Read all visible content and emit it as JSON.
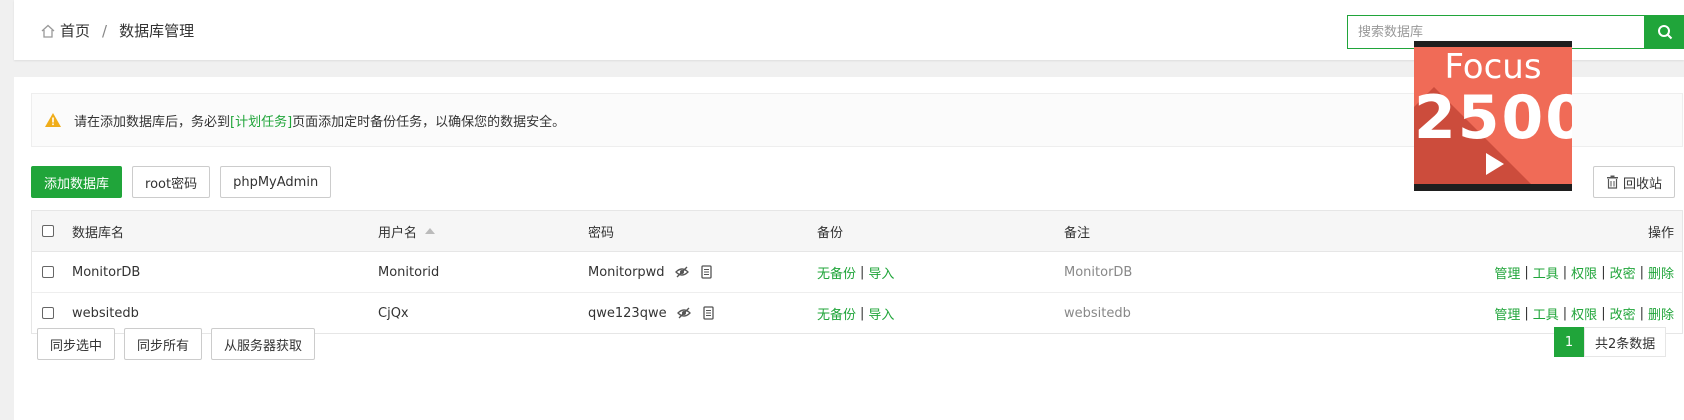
{
  "breadcrumb": {
    "home": "首页",
    "separator": "/",
    "current": "数据库管理"
  },
  "search": {
    "placeholder": "搜索数据库"
  },
  "notice": {
    "before": "请在添加数据库后，务必到",
    "link": "[计划任务]",
    "after": "页面添加定时备份任务，以确保您的数据安全。"
  },
  "toolbar": {
    "add": "添加数据库",
    "root": "root密码",
    "phpmyadmin": "phpMyAdmin",
    "recycle": "回收站"
  },
  "table": {
    "headers": {
      "name": "数据库名",
      "user": "用户名",
      "password": "密码",
      "backup": "备份",
      "remark": "备注",
      "ops": "操作"
    },
    "rows": [
      {
        "name": "MonitorDB",
        "user": "Monitorid",
        "password": "Monitorpwd",
        "backup": "无备份",
        "import": "导入",
        "remark": "MonitorDB",
        "ops": [
          "管理",
          "工具",
          "权限",
          "改密",
          "删除"
        ]
      },
      {
        "name": "websitedb",
        "user": "CjQx",
        "password": "qwe123qwe",
        "backup": "无备份",
        "import": "导入",
        "remark": "websitedb",
        "ops": [
          "管理",
          "工具",
          "权限",
          "改密",
          "删除"
        ]
      }
    ]
  },
  "bottom": {
    "sync_selected": "同步选中",
    "sync_all": "同步所有",
    "fetch": "从服务器获取"
  },
  "pager": {
    "current": "1",
    "total": "共2条数据"
  },
  "video_thumb": {
    "title": "Focus",
    "count": "2500"
  },
  "colors": {
    "accent": "#20a53a",
    "warning": "#f0ad1a",
    "thumb": "#f06b57"
  },
  "icons": [
    "home-icon",
    "search-icon",
    "warning-icon",
    "trash-icon",
    "sort-up-icon",
    "eye-off-icon",
    "copy-icon",
    "play-icon"
  ]
}
